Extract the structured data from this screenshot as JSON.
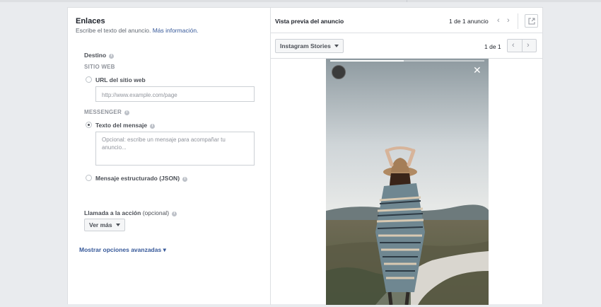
{
  "left": {
    "title": "Enlaces",
    "subtitle": "Escribe el texto del anuncio.",
    "subtitle_link": "Más información.",
    "destino_label": "Destino",
    "sitio_web_caption": "SITIO WEB",
    "url_option_label": "URL del sitio web",
    "url_placeholder": "http://www.example.com/page",
    "messenger_caption": "MESSENGER",
    "texto_option_label": "Texto del mensaje",
    "texto_placeholder": "Opcional: escribe un mensaje para acompañar tu anuncio...",
    "json_option_label": "Mensaje estructurado (JSON)",
    "cta_label": "Llamada a la acción",
    "cta_optional": "(opcional)",
    "cta_button": "Ver más",
    "advanced_link": "Mostrar opciones avanzadas",
    "advanced_link_suffix": "▾"
  },
  "right": {
    "title": "Vista previa del anuncio",
    "ad_count": "1 de 1 anuncio",
    "placement_dropdown": "Instagram Stories",
    "page_count": "1 de 1"
  },
  "icons": {
    "info": "info-icon",
    "prev": "chevron-left-icon",
    "next": "chevron-right-icon",
    "external": "external-link-icon",
    "close": "close-icon"
  },
  "colors": {
    "link": "#365899",
    "background": "#e9ebee"
  }
}
